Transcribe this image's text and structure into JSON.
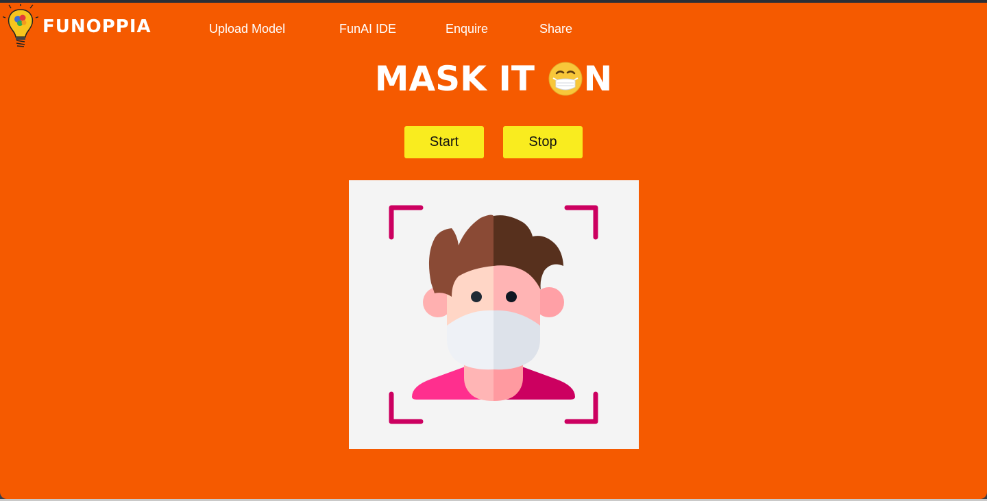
{
  "brand": {
    "name": "FUNOPPIA",
    "logo_icon": "lightbulb-brain-icon"
  },
  "nav": {
    "links": [
      "Upload Model",
      "FunAI IDE",
      "Enquire",
      "Share"
    ]
  },
  "title": {
    "text_before": "MASK IT ",
    "emoji": "face-with-medical-mask-icon",
    "text_after": "N"
  },
  "controls": {
    "start_label": "Start",
    "stop_label": "Stop"
  },
  "preview": {
    "illustration": "masked-person-face-scan-icon"
  },
  "colors": {
    "background": "#f55a00",
    "button": "#f9ec1f",
    "frame_corner": "#cc0060"
  }
}
